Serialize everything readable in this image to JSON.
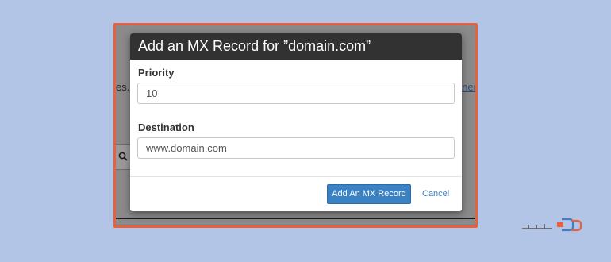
{
  "background": {
    "left_text": "es. U",
    "right_text": "ner",
    "search_icon": "search-icon"
  },
  "dialog": {
    "title": "Add an MX Record for ”domain.com”",
    "priority": {
      "label": "Priority",
      "value": "10"
    },
    "destination": {
      "label": "Destination",
      "value": "www.domain.com"
    },
    "submit_label": "Add An MX Record",
    "cancel_label": "Cancel"
  },
  "watermark": {
    "logo": "brand-logo"
  },
  "colors": {
    "frame": "#e8603c",
    "header": "#323232",
    "primary": "#3a82c4",
    "page": "#b3c5e6"
  }
}
